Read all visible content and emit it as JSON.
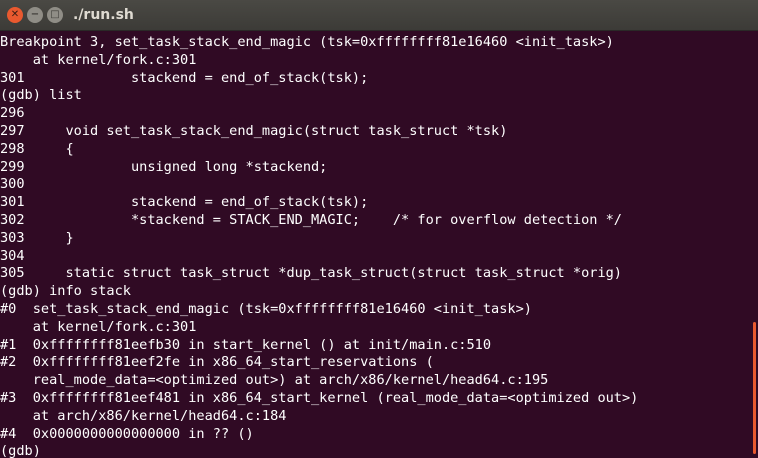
{
  "window": {
    "title": "./run.sh",
    "close_glyph": "✕",
    "min_glyph": "−",
    "max_glyph": "□"
  },
  "terminal": {
    "lines": [
      "Breakpoint 3, set_task_stack_end_magic (tsk=0xffffffff81e16460 <init_task>)",
      "    at kernel/fork.c:301",
      "301             stackend = end_of_stack(tsk);",
      "(gdb) list",
      "296",
      "297     void set_task_stack_end_magic(struct task_struct *tsk)",
      "298     {",
      "299             unsigned long *stackend;",
      "300",
      "301             stackend = end_of_stack(tsk);",
      "302             *stackend = STACK_END_MAGIC;    /* for overflow detection */",
      "303     }",
      "304",
      "305     static struct task_struct *dup_task_struct(struct task_struct *orig)",
      "(gdb) info stack",
      "#0  set_task_stack_end_magic (tsk=0xffffffff81e16460 <init_task>)",
      "    at kernel/fork.c:301",
      "#1  0xffffffff81eefb30 in start_kernel () at init/main.c:510",
      "#2  0xffffffff81eef2fe in x86_64_start_reservations (",
      "    real_mode_data=<optimized out>) at arch/x86/kernel/head64.c:195",
      "#3  0xffffffff81eef481 in x86_64_start_kernel (real_mode_data=<optimized out>)",
      "    at arch/x86/kernel/head64.c:184",
      "#4  0x0000000000000000 in ?? ()",
      "(gdb)"
    ]
  },
  "colors": {
    "terminal_bg": "#300a24",
    "text": "#ffffff",
    "titlebar": "#3c3b37",
    "close": "#e9592f",
    "scroll_thumb": "#e9592f"
  }
}
